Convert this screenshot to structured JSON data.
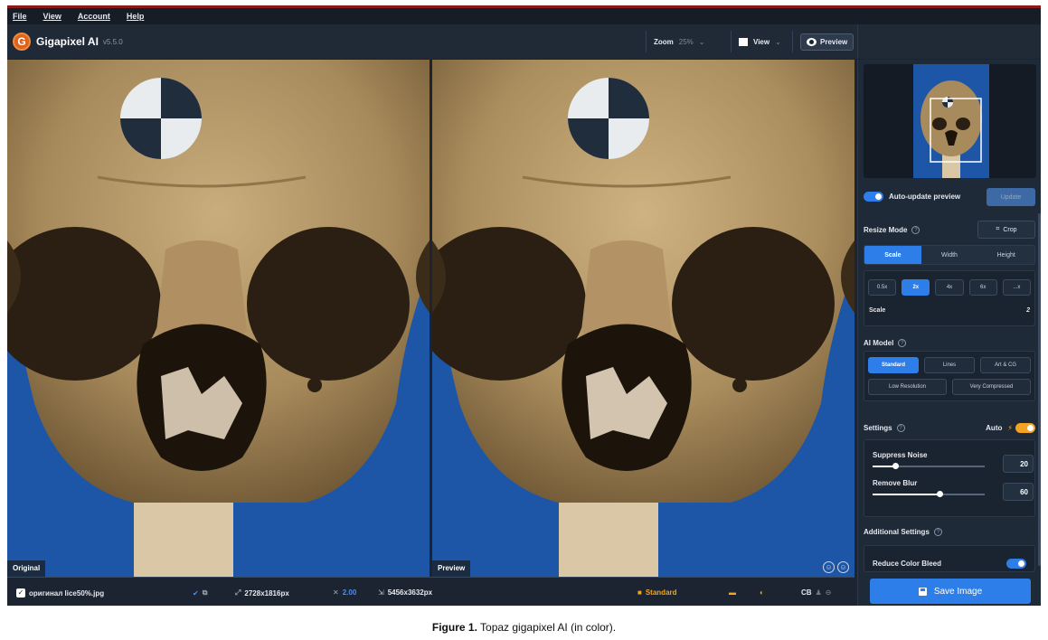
{
  "menu": {
    "items": [
      "File",
      "View",
      "Account",
      "Help"
    ]
  },
  "app": {
    "name": "Gigapixel AI",
    "version": "v5.5.0"
  },
  "toolbar": {
    "zoom_label": "Zoom",
    "zoom_value": "25%",
    "view_label": "View",
    "preview_label": "Preview"
  },
  "panes": {
    "left_label": "Original",
    "right_label": "Preview"
  },
  "statusbar": {
    "filename": "оригинал lice50%.jpg",
    "input_size": "2728x1816px",
    "scale": "2.00",
    "output_size": "5456x3632px",
    "model": "Standard",
    "cb": "CB"
  },
  "sidebar": {
    "auto_update_label": "Auto-update preview",
    "update_button": "Update",
    "resize_mode_label": "Resize Mode",
    "crop_button": "Crop",
    "resize_tabs": [
      "Scale",
      "Width",
      "Height"
    ],
    "scale_options": [
      "0.5x",
      "2x",
      "4x",
      "6x",
      "...x"
    ],
    "scale_label": "Scale",
    "scale_value": "2",
    "ai_model_label": "AI Model",
    "models_row1": [
      "Standard",
      "Lines",
      "Art & CG"
    ],
    "models_row2": [
      "Low Resolution",
      "Very Compressed"
    ],
    "settings_label": "Settings",
    "auto_label": "Auto",
    "suppress_noise_label": "Suppress Noise",
    "suppress_noise_value": "20",
    "remove_blur_label": "Remove Blur",
    "remove_blur_value": "60",
    "additional_settings_label": "Additional Settings",
    "reduce_color_bleed_label": "Reduce Color Bleed",
    "save_button": "Save Image"
  },
  "caption": {
    "figure": "Figure 1.",
    "text": "Topaz gigapixel AI (in color)."
  },
  "colors": {
    "accent": "#2d7ee8",
    "brand": "#e0621f",
    "highlight": "#f2a324",
    "background": "#1b2430"
  }
}
